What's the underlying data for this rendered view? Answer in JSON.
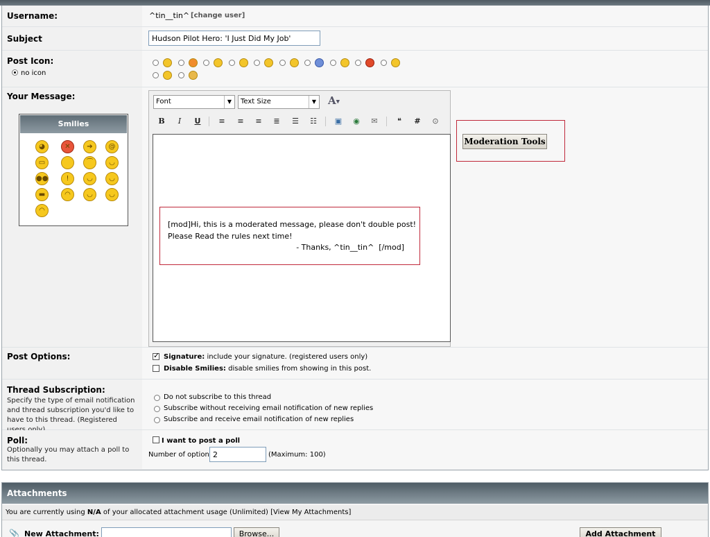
{
  "username": {
    "label": "Username:",
    "value": "^tin__tin^",
    "change_link": "[change user]"
  },
  "subject": {
    "label": "Subject",
    "value": "Hudson Pilot Hero: 'I Just Did My Job'"
  },
  "post_icon": {
    "label": "Post Icon:",
    "no_icon_label": "no icon"
  },
  "message": {
    "label": "Your Message:",
    "smilies_title": "Smilies",
    "font_select": "Font",
    "size_select": "Text Size",
    "body_line1": "[mod]Hi, this is a moderated message, please don't double post!",
    "body_line2": "Please Read the rules next time!",
    "body_line3": "- Thanks, ^tin__tin^  [/mod]"
  },
  "moderation_tools_button": "Moderation Tools",
  "post_options": {
    "label": "Post Options:",
    "signature_bold": "Signature:",
    "signature_text": "include your signature. (registered users only)",
    "smilies_bold": "Disable Smilies:",
    "smilies_text": "disable smilies from showing in this post."
  },
  "thread_subscription": {
    "label": "Thread Subscription:",
    "description": "Specify the type of email notification and thread subscription you'd like to have to this thread. (Registered users only)",
    "options": [
      "Do not subscribe to this thread",
      "Subscribe without receiving email notification of new replies",
      "Subscribe and receive email notification of new replies"
    ]
  },
  "poll": {
    "label": "Poll:",
    "description": "Optionally you may attach a poll to this thread.",
    "checkbox_label": "I want to post a poll",
    "options_label": "Number of options:",
    "options_value": "2",
    "maximum": "(Maximum: 100)"
  },
  "attachments": {
    "title": "Attachments",
    "usage_prefix": "You are currently using",
    "usage_value": "N/A",
    "usage_suffix": "of your allocated attachment usage (Unlimited) [View My Attachments]",
    "new_attachment_label": "New Attachment:",
    "browse_button": "Browse...",
    "add_button": "Add Attachment"
  }
}
